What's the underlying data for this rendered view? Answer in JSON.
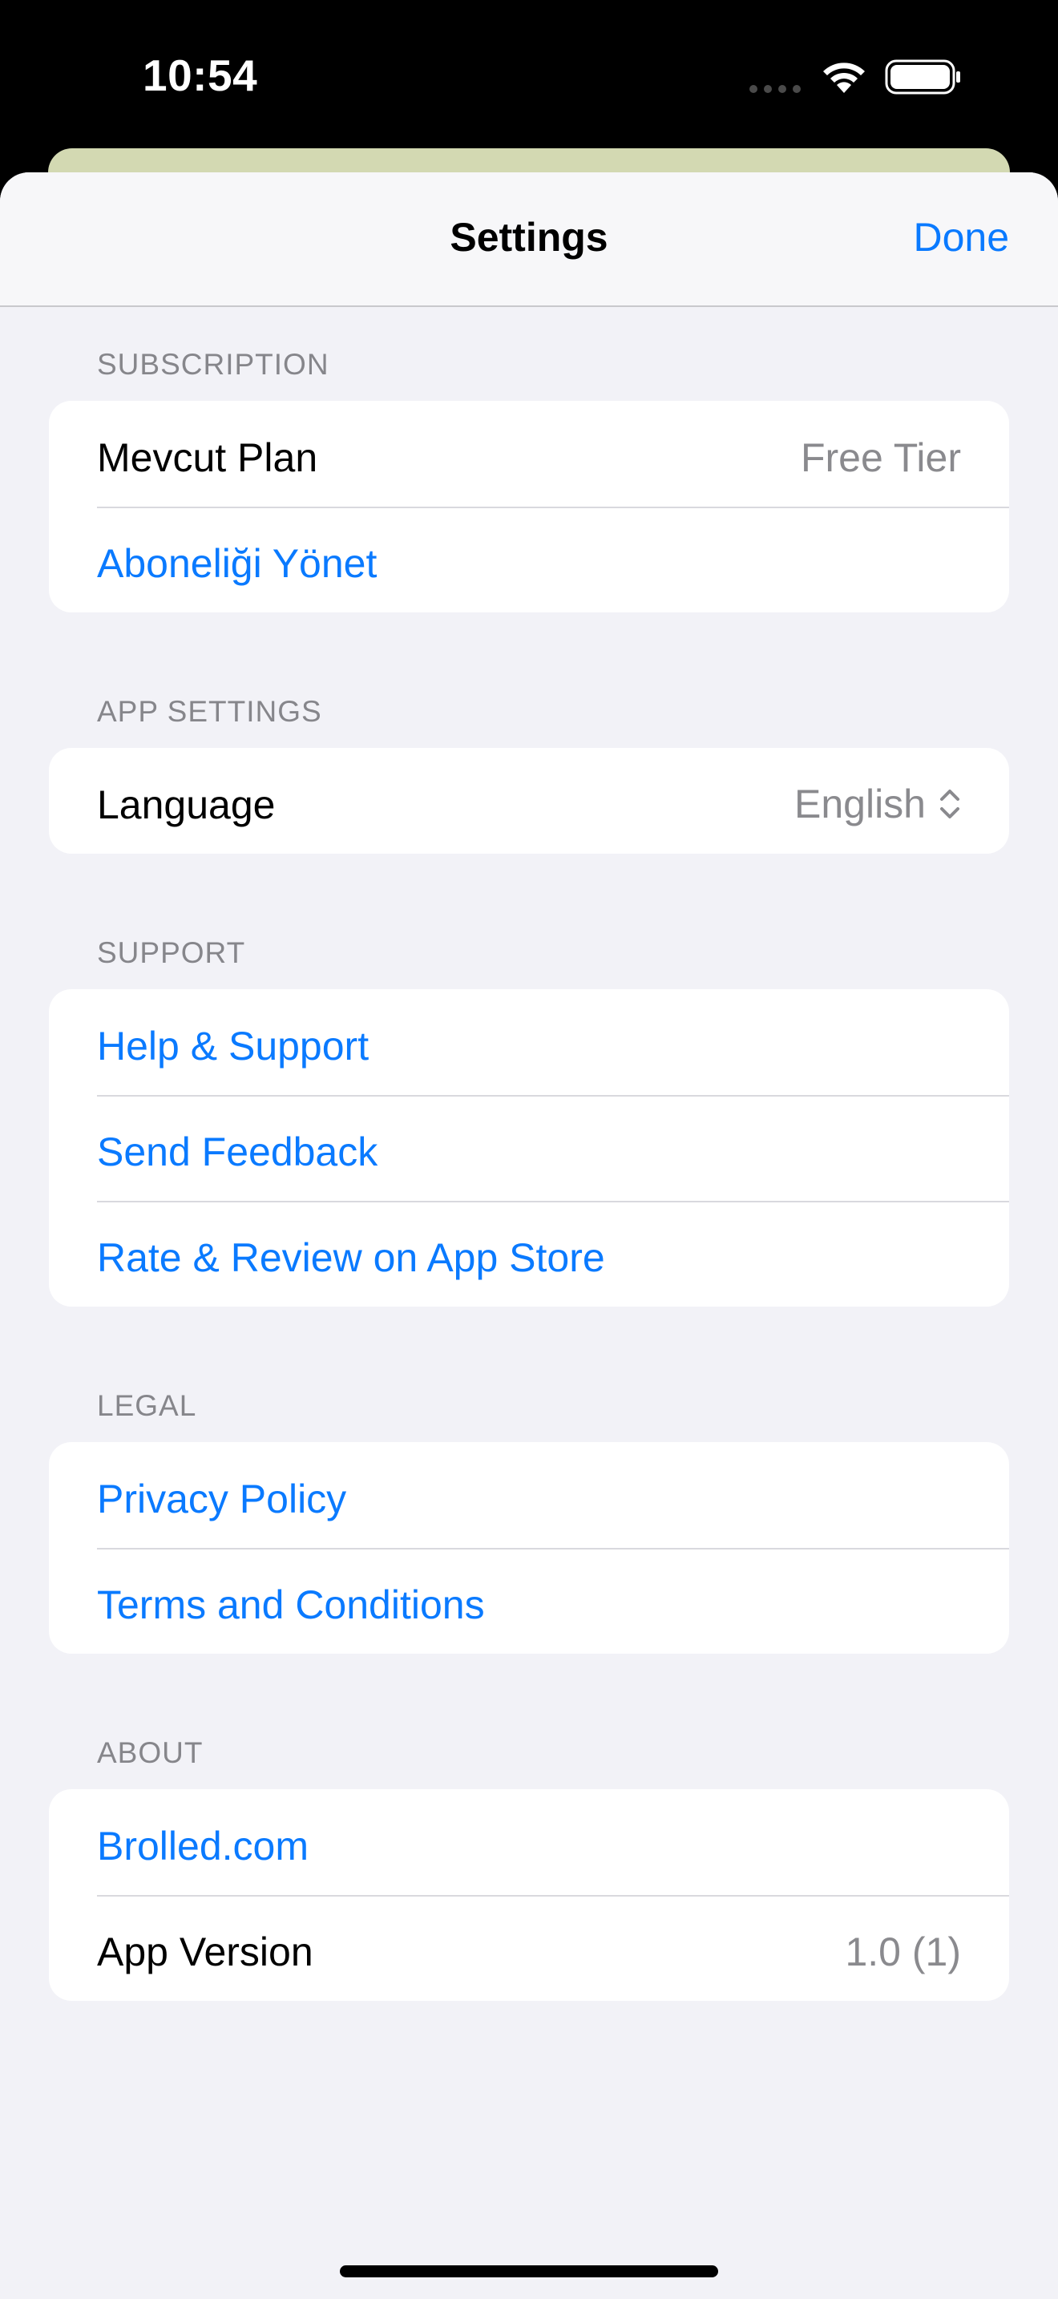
{
  "status_bar": {
    "time": "10:54"
  },
  "nav": {
    "title": "Settings",
    "done_label": "Done"
  },
  "sections": {
    "subscription": {
      "header": "SUBSCRIPTION",
      "current_plan_label": "Mevcut Plan",
      "current_plan_value": "Free Tier",
      "manage_label": "Aboneliği Yönet"
    },
    "app_settings": {
      "header": "APP SETTINGS",
      "language_label": "Language",
      "language_value": "English"
    },
    "support": {
      "header": "SUPPORT",
      "help_label": "Help & Support",
      "feedback_label": "Send Feedback",
      "rate_label": "Rate & Review on App Store"
    },
    "legal": {
      "header": "LEGAL",
      "privacy_label": "Privacy Policy",
      "terms_label": "Terms and Conditions"
    },
    "about": {
      "header": "ABOUT",
      "website_label": "Brolled.com",
      "version_label": "App Version",
      "version_value": "1.0 (1)"
    }
  },
  "colors": {
    "accent": "#0a7aff",
    "background": "#f2f2f7",
    "secondary_text": "#8a8a8e"
  },
  "icons": [
    "signal-icon",
    "wifi-icon",
    "battery-icon",
    "chevron-up-down-icon"
  ]
}
